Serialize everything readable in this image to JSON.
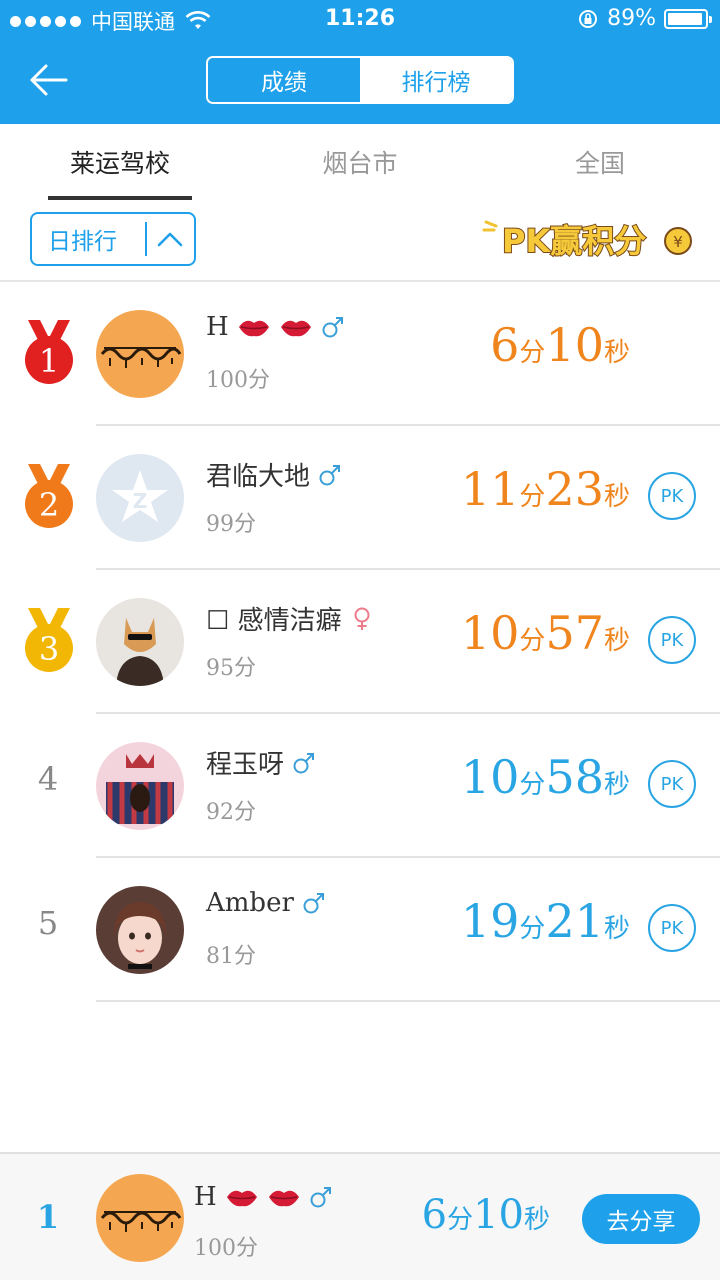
{
  "status_bar": {
    "carrier": "中国联通",
    "time": "11:26",
    "battery": "89%"
  },
  "header": {
    "segment_left": "成绩",
    "segment_right": "排行榜"
  },
  "region_tabs": [
    {
      "label": "莱运驾校",
      "active": true
    },
    {
      "label": "烟台市",
      "active": false
    },
    {
      "label": "全国",
      "active": false
    }
  ],
  "filter": {
    "label": "日排行"
  },
  "banner": {
    "text": "PK赢积分"
  },
  "rankings": [
    {
      "rank": "1",
      "name": "H",
      "gender": "male",
      "score": "100分",
      "minutes": "6",
      "min_unit": "分",
      "seconds": "10",
      "sec_unit": "秒",
      "pk": ""
    },
    {
      "rank": "2",
      "name": "君临大地",
      "gender": "male",
      "score": "99分",
      "minutes": "11",
      "min_unit": "分",
      "seconds": "23",
      "sec_unit": "秒",
      "pk": "PK"
    },
    {
      "rank": "3",
      "name": "☐ 感情洁癖",
      "gender": "female",
      "score": "95分",
      "minutes": "10",
      "min_unit": "分",
      "seconds": "57",
      "sec_unit": "秒",
      "pk": "PK"
    },
    {
      "rank": "4",
      "name": "程玉呀",
      "gender": "male",
      "score": "92分",
      "minutes": "10",
      "min_unit": "分",
      "seconds": "58",
      "sec_unit": "秒",
      "pk": "PK"
    },
    {
      "rank": "5",
      "name": "Amber",
      "gender": "male",
      "score": "81分",
      "minutes": "19",
      "min_unit": "分",
      "seconds": "21",
      "sec_unit": "秒",
      "pk": "PK"
    }
  ],
  "my_rank": {
    "rank": "1",
    "name": "H",
    "score": "100分",
    "minutes": "6",
    "min_unit": "分",
    "seconds": "10",
    "sec_unit": "秒",
    "share_label": "去分享"
  },
  "colors": {
    "brand_blue": "#1ea1ea",
    "time_orange": "#f0851d",
    "time_blue": "#2aa5e4",
    "gold_medal": "#e12020",
    "silver_medal": "#f07a1a",
    "bronze_medal": "#f2b705"
  }
}
